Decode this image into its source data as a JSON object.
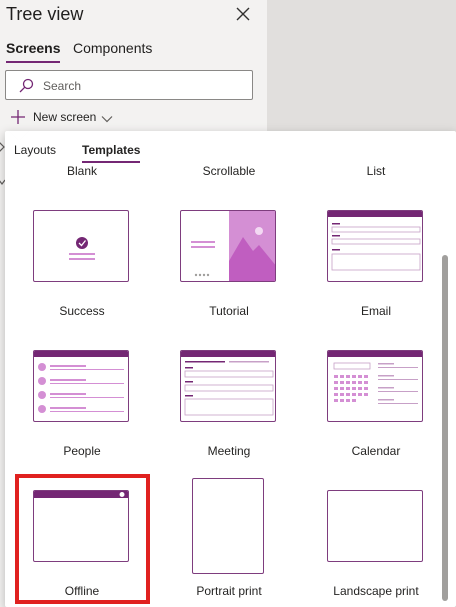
{
  "panel": {
    "title": "Tree view",
    "tabs": [
      {
        "label": "Screens"
      },
      {
        "label": "Components"
      }
    ],
    "search": {
      "placeholder": "Search"
    },
    "new_screen": {
      "label": "New screen"
    }
  },
  "flyout": {
    "tabs": [
      {
        "label": "Layouts"
      },
      {
        "label": "Templates"
      }
    ],
    "templates": [
      {
        "label": "Blank"
      },
      {
        "label": "Scrollable"
      },
      {
        "label": "List"
      },
      {
        "label": "Success"
      },
      {
        "label": "Tutorial"
      },
      {
        "label": "Email"
      },
      {
        "label": "People"
      },
      {
        "label": "Meeting"
      },
      {
        "label": "Calendar"
      },
      {
        "label": "Offline"
      },
      {
        "label": "Portrait print"
      },
      {
        "label": "Landscape print"
      }
    ]
  },
  "colors": {
    "accent": "#742774",
    "thumb_light": "#d48fd4",
    "highlight": "#e0211f"
  }
}
